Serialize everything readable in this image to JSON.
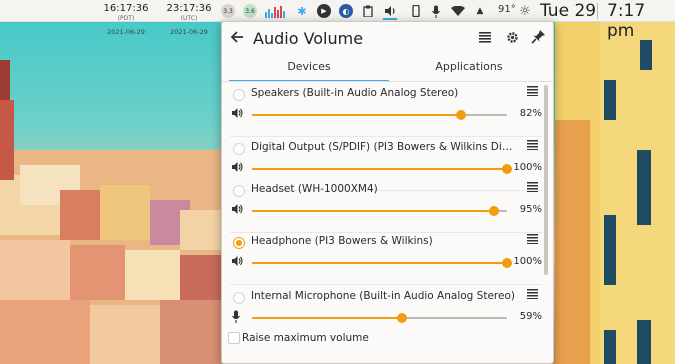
{
  "panel": {
    "clock1": {
      "time": "16:17:36",
      "zone": "(PDT)",
      "date": "2021-06-29"
    },
    "clock2": {
      "time": "23:17:36",
      "zone": "(UTC)",
      "date": "2021-06-29"
    },
    "tray_cpu": "3.3",
    "tray_mem": "3.6",
    "temperature": "91°",
    "date": "Tue 29",
    "time": "7:17 pm"
  },
  "popup": {
    "title": "Audio Volume",
    "tabs": [
      {
        "label": "Devices",
        "active": true
      },
      {
        "label": "Applications",
        "active": false
      }
    ],
    "devices": [
      {
        "name": "Speakers (Built-in Audio Analog Stereo)",
        "volume_label": "82%",
        "volume": 82,
        "selected": false,
        "icon": "speaker-icon"
      },
      {
        "name": "Digital Output (S/PDIF) (PI3 Bowers & Wilkins Digital ...",
        "volume_label": "100%",
        "volume": 100,
        "selected": false,
        "icon": "speaker-icon"
      },
      {
        "name": "Headset (WH-1000XM4)",
        "volume_label": "95%",
        "volume": 95,
        "selected": false,
        "icon": "speaker-icon"
      },
      {
        "name": "Headphone (PI3 Bowers & Wilkins)",
        "volume_label": "100%",
        "volume": 100,
        "selected": true,
        "icon": "speaker-icon"
      },
      {
        "name": "Internal Microphone (Built-in Audio Analog Stereo)",
        "volume_label": "59%",
        "volume": 59,
        "selected": false,
        "icon": "microphone-icon"
      }
    ],
    "raise_max_label": "Raise maximum volume"
  },
  "colors": {
    "accent": "#f39c12",
    "tab_underline": "#3daee9"
  }
}
